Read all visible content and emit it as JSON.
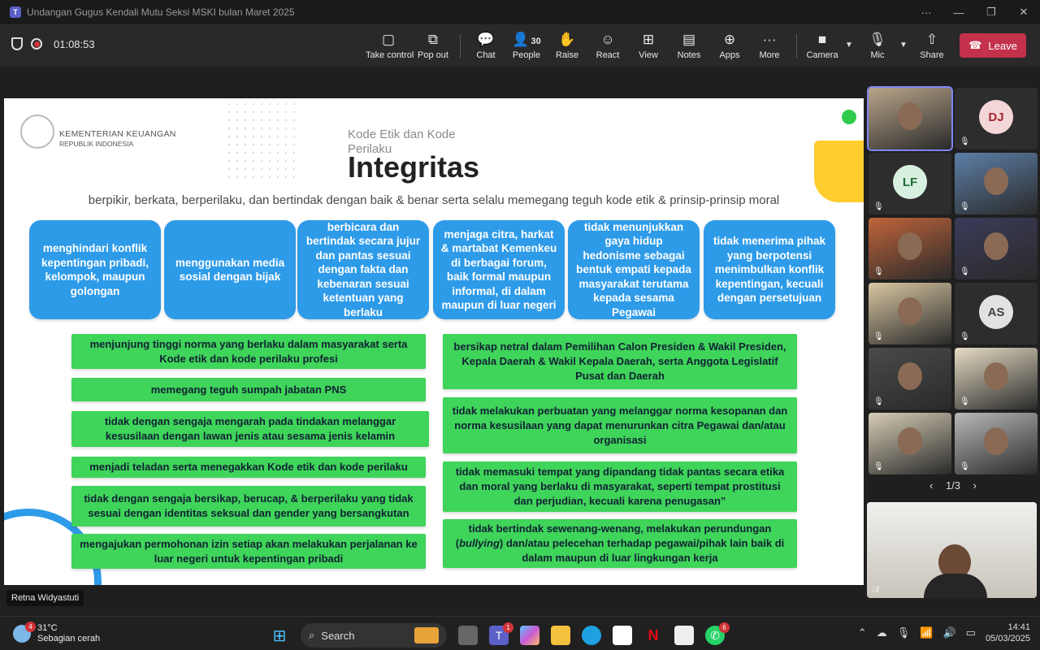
{
  "window": {
    "title": "Undangan Gugus Kendali Mutu Seksi MSKI bulan Maret 2025",
    "controls": [
      "···",
      "—",
      "❐",
      "✕"
    ]
  },
  "meeting": {
    "timer": "01:08:53",
    "toolbar": [
      {
        "label": "Take control",
        "icon": "take-control-icon",
        "glyph": "▢"
      },
      {
        "label": "Pop out",
        "icon": "pop-out-icon",
        "glyph": "⧉"
      },
      {
        "label": "Chat",
        "icon": "chat-icon",
        "glyph": "💬"
      },
      {
        "label": "People",
        "icon": "people-icon",
        "glyph": "👤",
        "count": "30"
      },
      {
        "label": "Raise",
        "icon": "hand-icon",
        "glyph": "✋"
      },
      {
        "label": "React",
        "icon": "react-icon",
        "glyph": "☺"
      },
      {
        "label": "View",
        "icon": "view-icon",
        "glyph": "⊞"
      },
      {
        "label": "Notes",
        "icon": "notes-icon",
        "glyph": "▤"
      },
      {
        "label": "Apps",
        "icon": "apps-icon",
        "glyph": "⊕"
      },
      {
        "label": "More",
        "icon": "more-icon",
        "glyph": "···"
      },
      {
        "label": "Camera",
        "icon": "camera-icon",
        "glyph": "■"
      },
      {
        "label": "Mic",
        "icon": "mic-off-icon",
        "glyph": "🎙"
      },
      {
        "label": "Share",
        "icon": "share-icon",
        "glyph": "⇧"
      }
    ],
    "leave_label": "Leave",
    "speaker_name": "Retna Widyastuti",
    "pager": "1/3"
  },
  "slide": {
    "org_line1": "KEMENTERIAN KEUANGAN",
    "org_line2": "REPUBLIK INDONESIA",
    "kicker": "Kode Etik dan Kode Perilaku",
    "title": "Integritas",
    "subtitle": "berpikir, berkata, berperilaku, dan bertindak dengan baik & benar serta selalu memegang teguh kode etik & prinsip-prinsip moral",
    "blue_boxes": [
      "menghindari konflik kepentingan pribadi, kelompok, maupun golongan",
      "menggunakan media sosial dengan bijak",
      "berbicara dan bertindak secara jujur dan pantas sesuai dengan fakta dan kebenaran sesuai ketentuan yang berlaku",
      "menjaga citra, harkat & martabat Kemenkeu di berbagai forum, baik formal maupun informal, di dalam maupun di luar negeri",
      "tidak menunjukkan gaya hidup hedonisme sebagai bentuk empati kepada masyarakat terutama kepada sesama Pegawai",
      "tidak menerima pihak yang berpotensi menimbulkan konflik kepentingan, kecuali dengan persetujuan"
    ],
    "green_left": [
      "menjunjung tinggi norma yang berlaku dalam masyarakat serta Kode etik dan kode perilaku profesi",
      "memegang teguh sumpah jabatan PNS",
      "tidak dengan sengaja mengarah pada tindakan melanggar kesusilaan dengan lawan jenis atau sesama jenis kelamin",
      "menjadi teladan serta menegakkan Kode etik dan kode perilaku",
      "tidak dengan sengaja bersikap, berucap, & berperilaku yang tidak sesuai dengan identitas seksual dan gender yang bersangkutan",
      "mengajukan permohonan izin setiap akan melakukan perjalanan ke luar negeri untuk kepentingan pribadi"
    ],
    "green_right": [
      {
        "pre": "bersikap netral dalam Pemilihan Calon Presiden & Wakil Presiden, Kepala Daerah & Wakil Kepala Daerah, serta Anggota Legislatif Pusat dan Daerah",
        "em": "",
        "post": ""
      },
      {
        "pre": "tidak melakukan perbuatan yang melanggar norma kesopanan dan norma kesusilaan yang dapat menurunkan citra Pegawai dan/atau organisasi",
        "em": "",
        "post": ""
      },
      {
        "pre": "tidak memasuki tempat yang dipandang tidak pantas secara etika dan moral yang berlaku di masyarakat, seperti tempat prostitusi dan perjudian, kecuali karena penugasan”",
        "em": "",
        "post": ""
      },
      {
        "pre": "tidak bertindak sewenang-wenang, melakukan perundungan (",
        "em": "bullying",
        "post": ") dan/atau pelecehan terhadap pegawai/pihak lain baik di dalam maupun di luar lingkungan kerja"
      }
    ]
  },
  "participants": [
    {
      "kind": "video",
      "color": "#b9a58a",
      "selected": true
    },
    {
      "kind": "avatar",
      "initials": "DJ",
      "bg": "#f3d6d8",
      "fg": "#a4262c"
    },
    {
      "kind": "avatar",
      "initials": "LF",
      "bg": "#d8f0e0",
      "fg": "#1e6b3a"
    },
    {
      "kind": "video",
      "color": "#5d7fa8"
    },
    {
      "kind": "video",
      "color": "#c0643a"
    },
    {
      "kind": "photo",
      "color": "#3b3b5a"
    },
    {
      "kind": "video",
      "color": "#d9c7a2"
    },
    {
      "kind": "avatar",
      "initials": "AS",
      "bg": "#e2e2e2",
      "fg": "#444"
    },
    {
      "kind": "photo",
      "color": "#4a4a4a"
    },
    {
      "kind": "video",
      "color": "#e6dcc4"
    },
    {
      "kind": "video",
      "color": "#d6cdb5"
    },
    {
      "kind": "video",
      "color": "#b8b8b8"
    }
  ],
  "taskbar": {
    "weather_temp": "31°C",
    "weather_desc": "Sebagian cerah",
    "weather_badge": "4",
    "search_placeholder": "Search",
    "teams_badge": "1",
    "whatsapp_badge": "6",
    "time": "14:41",
    "date": "05/03/2025"
  }
}
